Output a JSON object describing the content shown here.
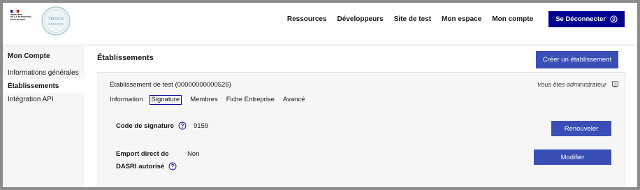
{
  "header": {
    "gov_logo_lines": [
      "MINISTÈRE",
      "DE LA TRANSITION",
      "ÉCOLOGIQUE"
    ],
    "app_logo": {
      "line1": "TRACK",
      "line2": "DÉCHETS"
    },
    "nav": [
      "Ressources",
      "Développeurs",
      "Site de test",
      "Mon espace",
      "Mon compte"
    ],
    "logout_label": "Se Déconnecter"
  },
  "sidebar": {
    "title": "Mon Compte",
    "items": [
      "Informations générales",
      "Établissements",
      "Intégration API"
    ],
    "active_index": 1
  },
  "main": {
    "title": "Établissements",
    "create_button": "Créer un établissement",
    "card": {
      "title": "Établissement de test (00000000000526)",
      "role_text": "Vous êtes administrateur",
      "tabs": [
        "Information",
        "Signature",
        "Membres",
        "Fiche Entreprise",
        "Avancé"
      ],
      "active_tab": "Signature",
      "rows": [
        {
          "label": "Code de signature",
          "value": "9159",
          "button": "Renouveler"
        },
        {
          "label_line1": "Emport direct de",
          "label_line2": "DASRI autorisé",
          "value": "Non",
          "button": "Modifier"
        }
      ]
    }
  },
  "colors": {
    "primary_navy": "#000091",
    "button_blue": "#3a4fb5",
    "flag_blue": "#000091",
    "flag_red": "#e1000f"
  },
  "icons": [
    "user-circle-icon",
    "help-circle-icon",
    "edit-icon"
  ]
}
